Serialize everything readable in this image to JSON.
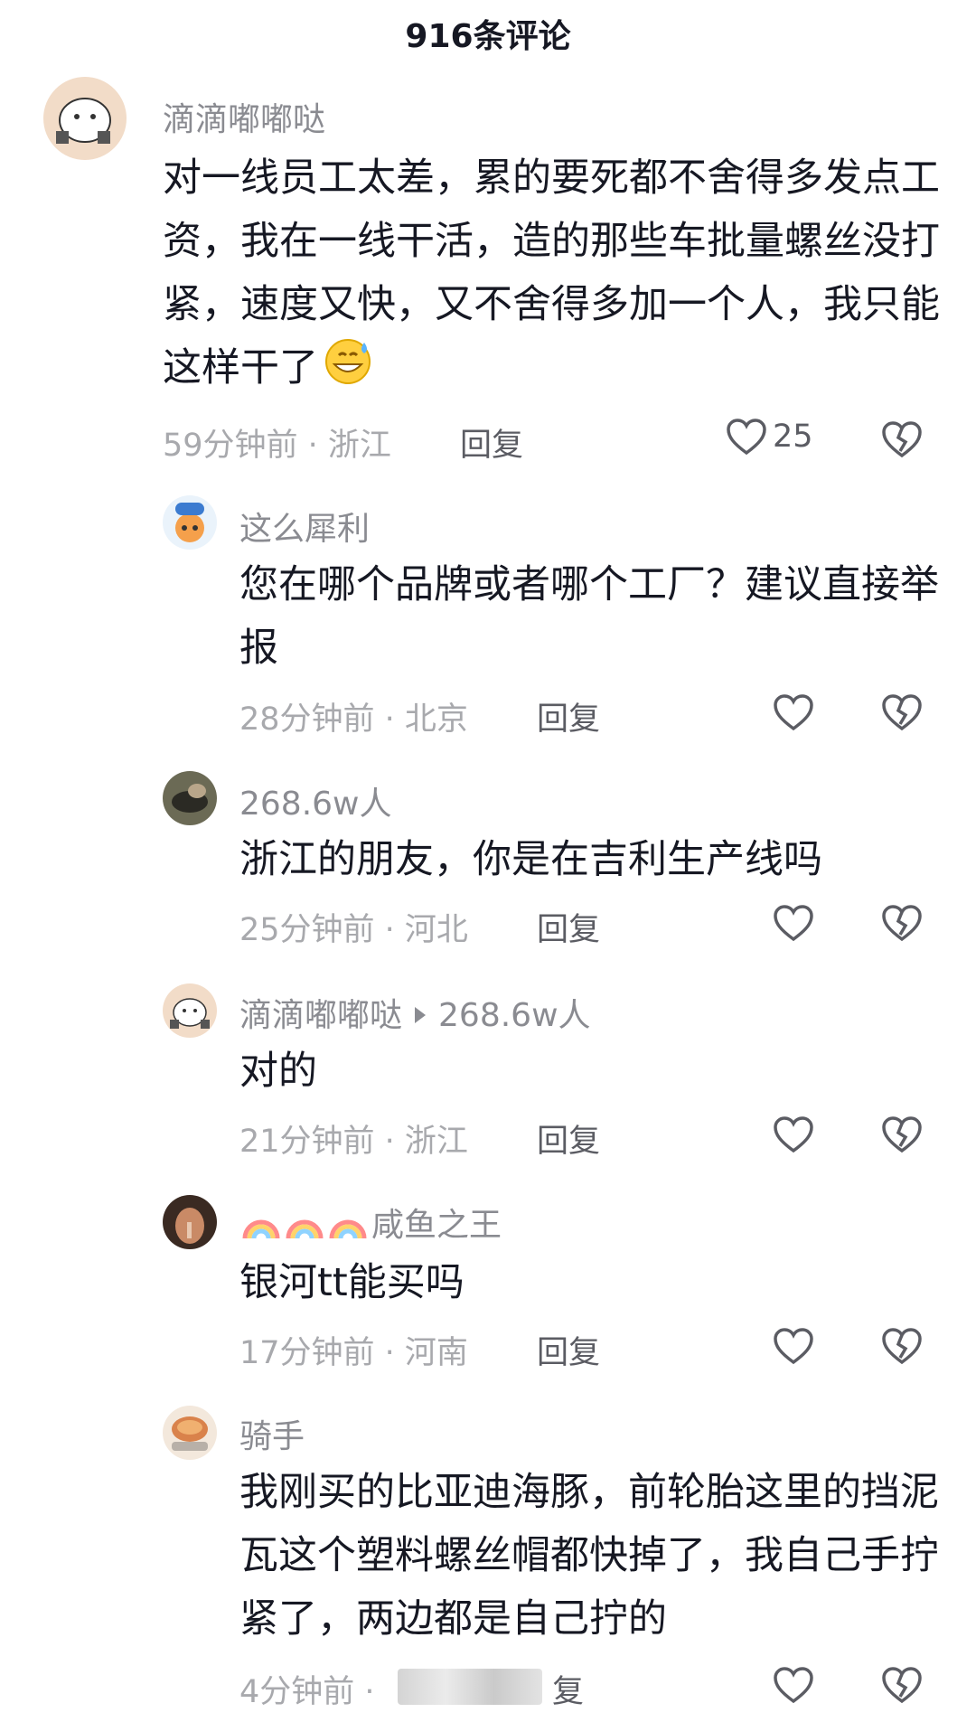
{
  "header": {
    "title": "916条评论"
  },
  "comments": [
    {
      "username": "滴滴嘟嘟哒",
      "text": "对一线员工太差，累的要死都不舍得多发点工资，我在一线干活，造的那些车批量螺丝没打紧，速度又快，又不舍得多加一个人，我只能这样干了",
      "meta": "59分钟前 · 浙江",
      "reply_label": "回复",
      "likes": "25"
    },
    {
      "username": "这么犀利",
      "text": "您在哪个品牌或者哪个工厂？建议直接举报",
      "meta": "28分钟前 · 北京",
      "reply_label": "回复"
    },
    {
      "username": "268.6w人",
      "text": "浙江的朋友，你是在吉利生产线吗",
      "meta": "25分钟前 · 河北",
      "reply_label": "回复"
    },
    {
      "username": "滴滴嘟嘟哒",
      "reply_to": "268.6w人",
      "text": "对的",
      "meta": "21分钟前 · 浙江",
      "reply_label": "回复"
    },
    {
      "username": "咸鱼之王",
      "text": "银河tt能买吗",
      "meta": "17分钟前 · 河南",
      "reply_label": "回复"
    },
    {
      "username": "骑手",
      "text": "我刚买的比亚迪海豚，前轮胎这里的挡泥瓦这个塑料螺丝帽都快掉了，我自己手拧紧了，两边都是自己拧的",
      "meta": "4分钟前 ·",
      "reply_label": "复"
    }
  ],
  "colors": {
    "text": "#161823",
    "secondary": "#8a8b91",
    "meta": "#a8a9ad"
  }
}
